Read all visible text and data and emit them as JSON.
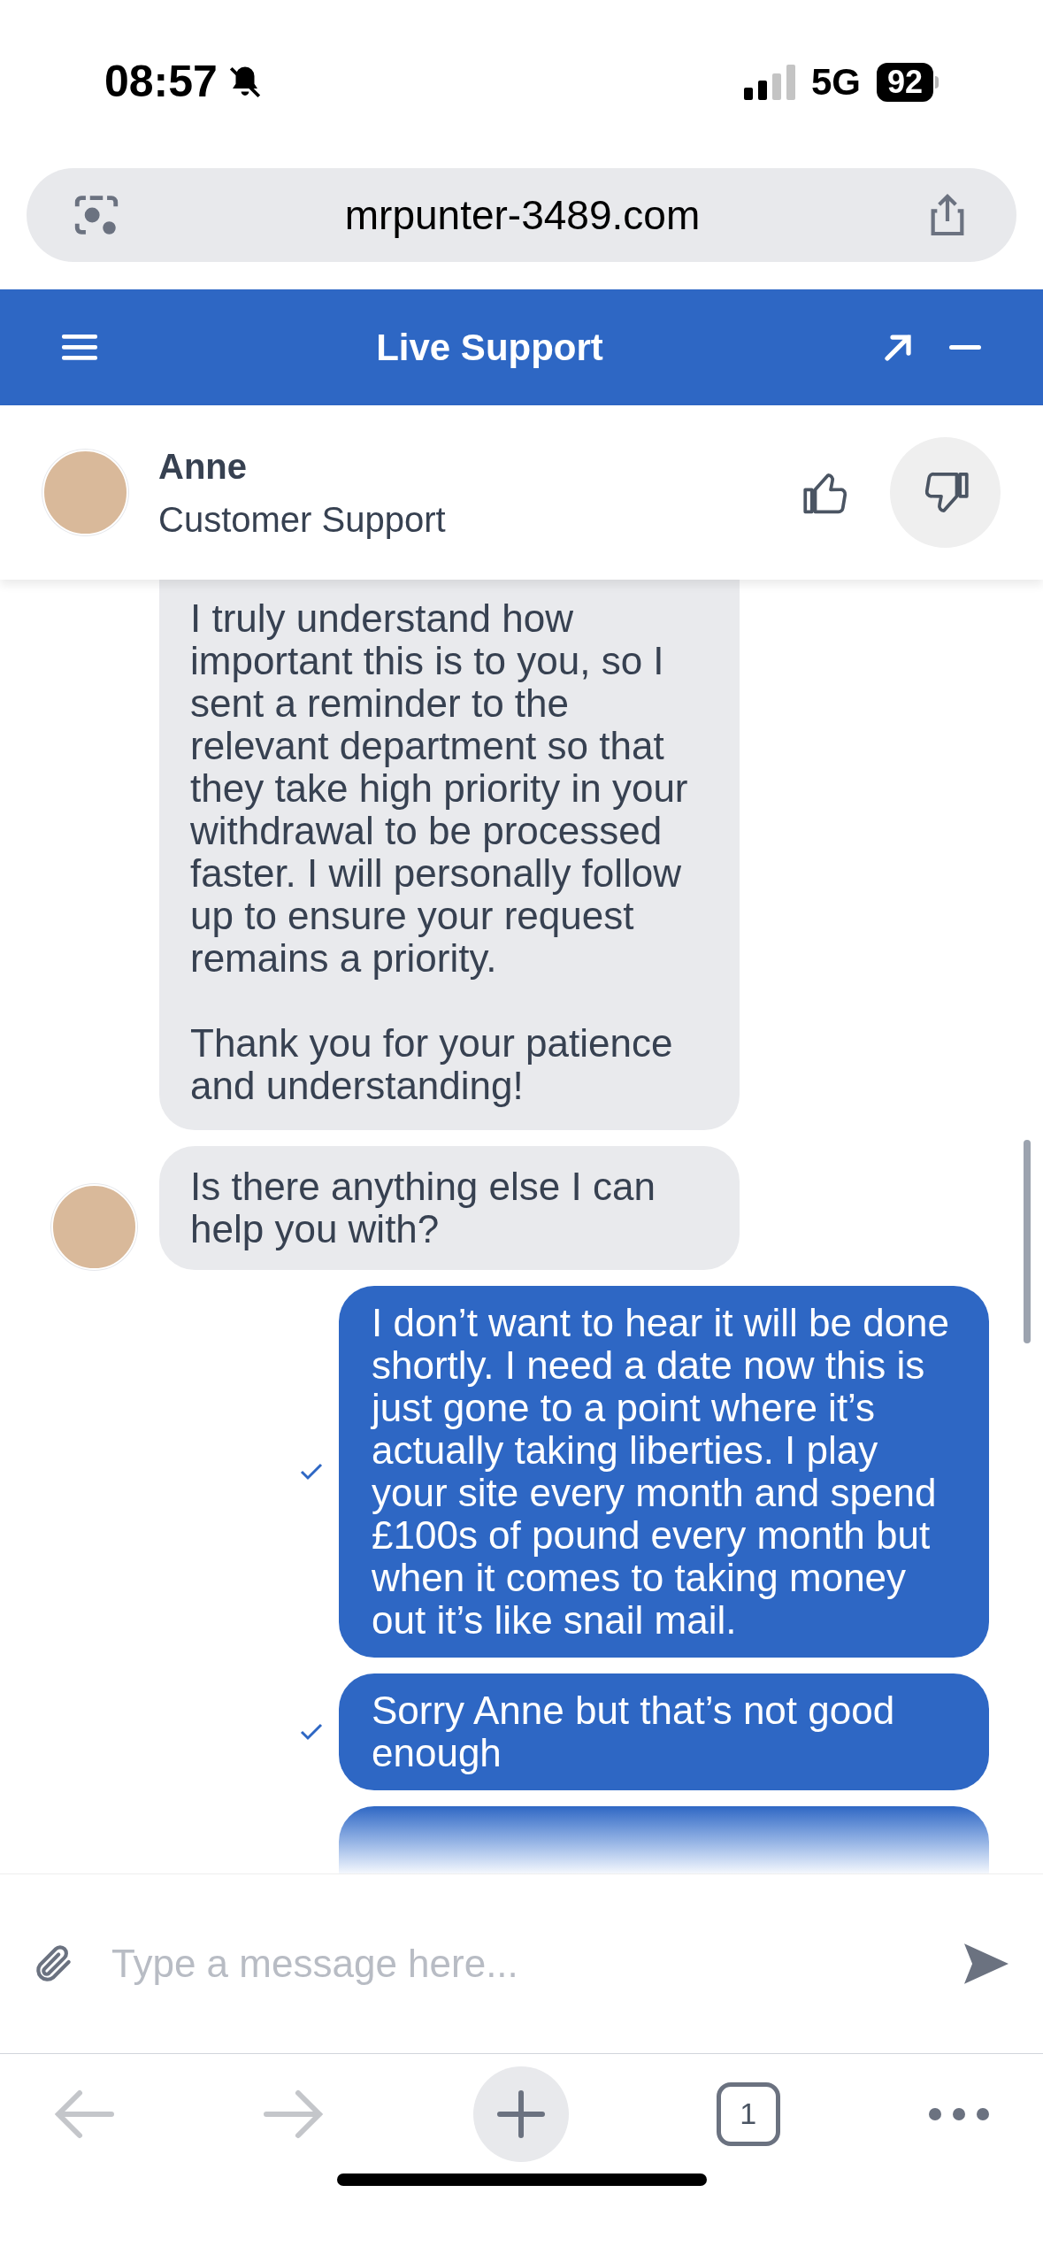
{
  "status_bar": {
    "time": "08:57",
    "network": "5G",
    "battery": "92"
  },
  "browser": {
    "url": "mrpunter-3489.com"
  },
  "header": {
    "title": "Live Support"
  },
  "agent": {
    "name": "Anne",
    "role": "Customer Support"
  },
  "feedback": [
    {
      "kind": "up",
      "selected": false
    },
    {
      "kind": "down",
      "selected": true
    }
  ],
  "messages": [
    {
      "kind": "agent",
      "avatar": false,
      "text": "I truly understand how important this is to you, so I sent a reminder to the relevant department so that they take high priority in your withdrawal to be processed faster. I will personally follow up to ensure your request remains a priority.\n\nThank you for your patience and understanding!"
    },
    {
      "kind": "agent",
      "avatar": true,
      "text": "Is there anything else I can help you with?"
    },
    {
      "kind": "user",
      "delivered": true,
      "text": "I don’t want to hear it will be done shortly. I need a date now this is just gone to a point where it’s actually taking liberties. I play your site every month and spend £100s of pound every month but when it comes to taking money out it’s like snail mail."
    },
    {
      "kind": "user",
      "delivered": true,
      "text": "Sorry Anne but that’s not good enough"
    }
  ],
  "composer": {
    "placeholder": "Type a message here..."
  },
  "toolbar": {
    "tab_count": "1"
  }
}
